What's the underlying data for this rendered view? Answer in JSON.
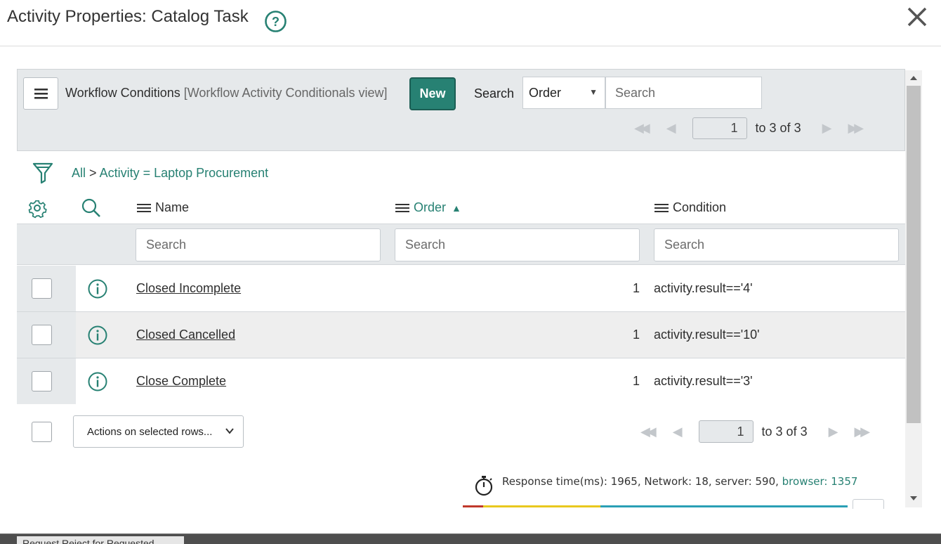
{
  "dialog": {
    "title": "Activity Properties: Catalog Task"
  },
  "list": {
    "title": "Workflow Conditions",
    "view": "[Workflow Activity Conditionals view]",
    "new_label": "New",
    "search_label": "Search",
    "search_field": "Order",
    "search_placeholder": "Search",
    "pager": {
      "page": "1",
      "of_label": "to 3 of 3"
    }
  },
  "breadcrumb": {
    "all": "All",
    "separator": ">",
    "filter": "Activity = Laptop Procurement"
  },
  "columns": {
    "name": "Name",
    "order": "Order",
    "condition": "Condition",
    "search_placeholder": "Search"
  },
  "rows": [
    {
      "name": "Closed Incomplete",
      "order": "1",
      "condition": "activity.result=='4'"
    },
    {
      "name": "Closed Cancelled",
      "order": "1",
      "condition": "activity.result=='10'"
    },
    {
      "name": "Close Complete",
      "order": "1",
      "condition": "activity.result=='3'"
    }
  ],
  "footer": {
    "actions_label": "Actions on selected rows...",
    "pager": {
      "page": "1",
      "of_label": "to 3 of 3"
    },
    "response_time": "Response time(ms): 1965, Network: 18, server: 590,",
    "browser_time": "browser: 1357"
  },
  "background_page": {
    "tab_label": "Request Reject for Requested"
  },
  "colors": {
    "accent": "#278173",
    "header_bg": "#e6e9eb",
    "timing_network": "#c0392b",
    "timing_server": "#e9c81d",
    "timing_browser": "#2a9fb5"
  },
  "icons": [
    "help-icon",
    "close-icon",
    "menu-icon",
    "filter-icon",
    "gear-icon",
    "search-icon",
    "info-icon",
    "stopwatch-icon",
    "chevron-down-icon"
  ]
}
